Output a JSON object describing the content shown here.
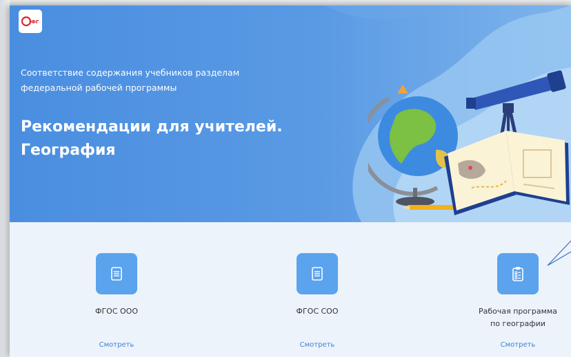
{
  "logo": {
    "label": "ФГОС"
  },
  "hero": {
    "subtitle": "Соответствие содержания учебников разделам федеральной рабочей программы",
    "title_line1": "Рекомендации для учителей.",
    "title_line2": "География"
  },
  "cards": [
    {
      "label": "ФГОС ООО",
      "link": "Смотреть",
      "icon": "document-icon"
    },
    {
      "label": "ФГОС СОО",
      "link": "Смотреть",
      "icon": "document-icon"
    },
    {
      "label_line1": "Рабочая программа",
      "label_line2": "по географии",
      "link": "Смотреть",
      "icon": "checklist-icon"
    }
  ],
  "colors": {
    "hero": "#4a8ee0",
    "card_icon_bg": "#5ba3ec",
    "link": "#3f7fd4",
    "background": "#ecf3fb"
  }
}
